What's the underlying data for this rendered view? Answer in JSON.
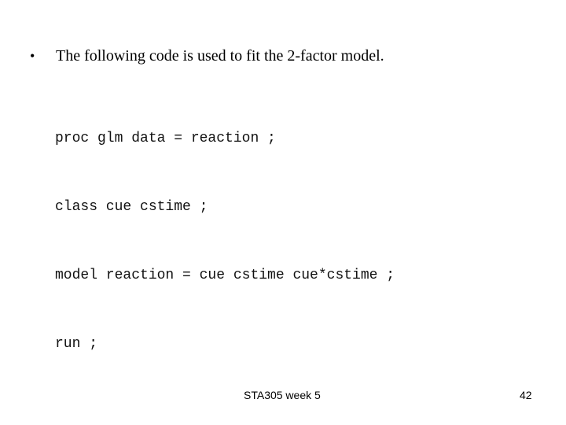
{
  "slide": {
    "bullet_symbol": "•",
    "bullet_text": "The following code is used to fit the 2-factor model.",
    "code_lines": [
      "proc glm data = reaction ;",
      "class cue cstime ;",
      "model reaction = cue cstime cue*cstime ;",
      "run ;"
    ]
  },
  "footer": {
    "course": "STA305 week 5",
    "page_number": "42"
  }
}
